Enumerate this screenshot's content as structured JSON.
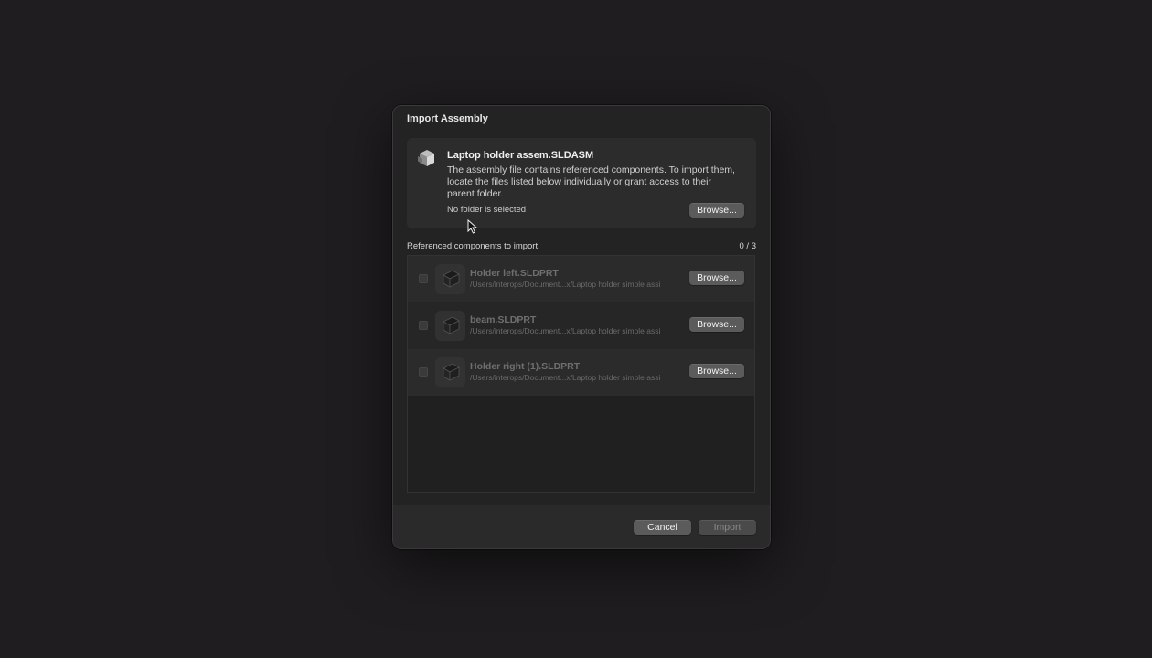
{
  "dialog": {
    "title": "Import Assembly",
    "assembly": {
      "icon": "assembly-cube-icon",
      "name": "Laptop holder assem.SLDASM",
      "description": "The assembly file contains referenced components. To import them, locate the files listed below individually or grant access to their parent folder.",
      "folder_status": "No folder is selected",
      "browse_label": "Browse..."
    },
    "references": {
      "label": "Referenced components to import:",
      "count": "0 / 3",
      "items": [
        {
          "name": "Holder left.SLDPRT",
          "path": "/Users/interops/Document...x/Laptop holder simple assi",
          "icon": "part-icon",
          "checked": false,
          "browse_label": "Browse..."
        },
        {
          "name": "beam.SLDPRT",
          "path": "/Users/interops/Document...x/Laptop holder simple assi",
          "icon": "part-icon",
          "checked": false,
          "browse_label": "Browse..."
        },
        {
          "name": "Holder right (1).SLDPRT",
          "path": "/Users/interops/Document...x/Laptop holder simple assi",
          "icon": "part-icon",
          "checked": false,
          "browse_label": "Browse..."
        }
      ]
    },
    "footer": {
      "cancel_label": "Cancel",
      "import_label": "Import",
      "import_enabled": false
    }
  },
  "colors": {
    "background": "#1f1d1f",
    "dialog": "#232323",
    "button": "#5b5b5b",
    "disabled_text": "#6f6f6f"
  }
}
